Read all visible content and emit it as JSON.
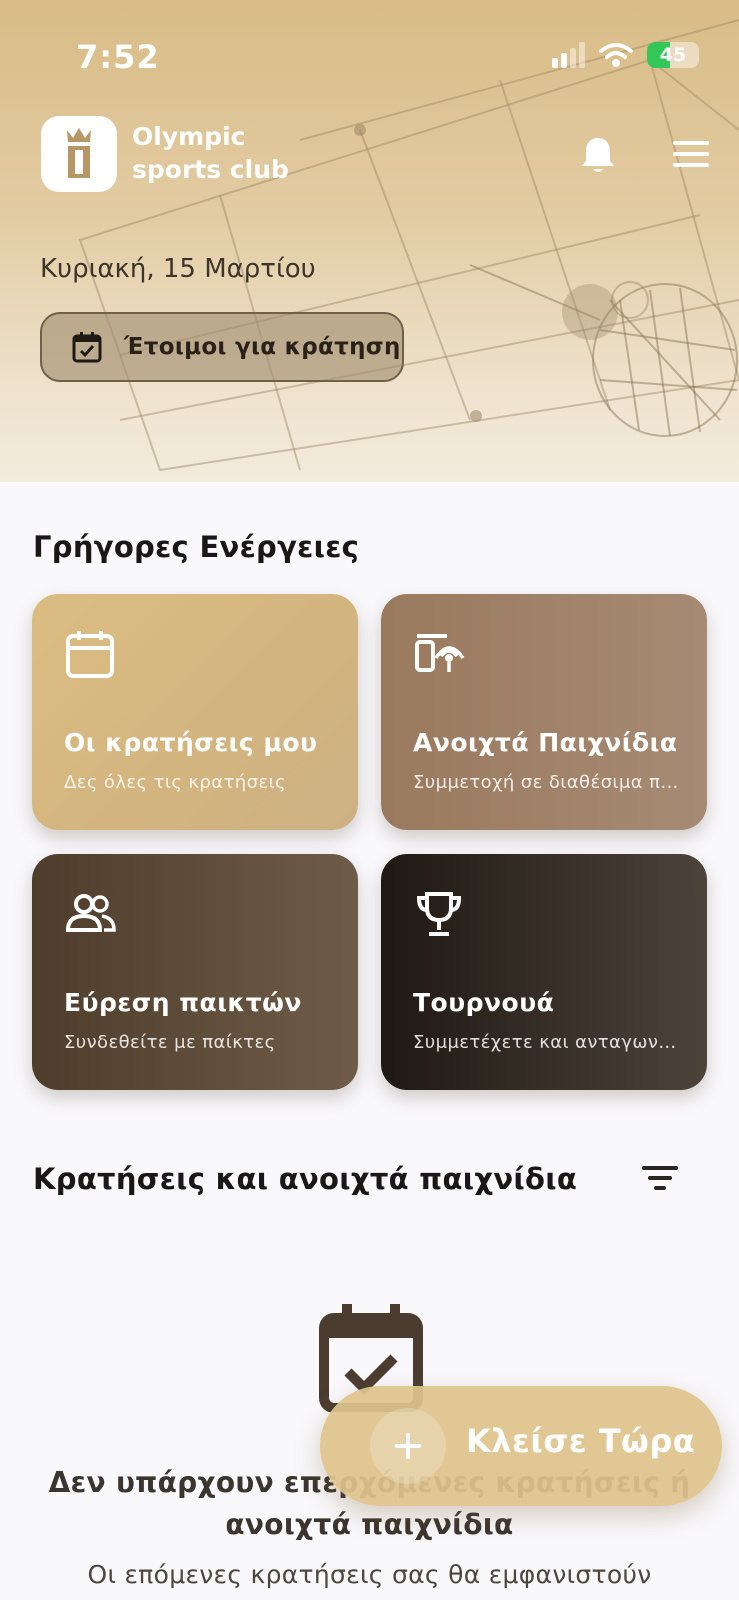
{
  "status_bar": {
    "time": "7:52",
    "battery": "45",
    "icons": [
      "signal-icon",
      "wifi-icon",
      "battery-charging-icon"
    ]
  },
  "header": {
    "brand_line1": "Olympic",
    "brand_line2": "sports club",
    "icons": [
      "logo-icon",
      "bell-icon",
      "menu-icon"
    ]
  },
  "hero": {
    "date": "Κυριακή, 15 Μαρτίου",
    "ready_button": "Έτοιμοι για κράτηση"
  },
  "quick_actions": {
    "title": "Γρήγορες Ενέργειες",
    "cards": [
      {
        "title": "Οι κρατήσεις μου",
        "subtitle": "Δες όλες τις κρατήσεις",
        "icon": "calendar-icon"
      },
      {
        "title": "Ανοιχτά Παιχνίδια",
        "subtitle": "Συμμετοχή σε διαθέσιμα παιχνίδια",
        "icon": "court-broadcast-icon"
      },
      {
        "title": "Εύρεση παικτών",
        "subtitle": "Συνδεθείτε με παίκτες",
        "icon": "people-icon"
      },
      {
        "title": "Τουρνουά",
        "subtitle": "Συμμετέχετε και ανταγωνιστείτε",
        "icon": "trophy-icon"
      }
    ]
  },
  "bookings": {
    "title": "Κρατήσεις και ανοιχτά παιχνίδια",
    "empty_title": "Δεν υπάρχουν επερχόμενες κρατήσεις ή ανοιχτά παιχνίδια",
    "empty_subtitle": "Οι επόμενες κρατήσεις σας θα εμφανιστούν"
  },
  "fab": {
    "label": "Κλείσε Τώρα",
    "icon": "plus-icon"
  },
  "colors": {
    "hero_gold": "#d9bc87",
    "accent_gold": "#dec38c",
    "dark_brown": "#4e3d2c"
  }
}
